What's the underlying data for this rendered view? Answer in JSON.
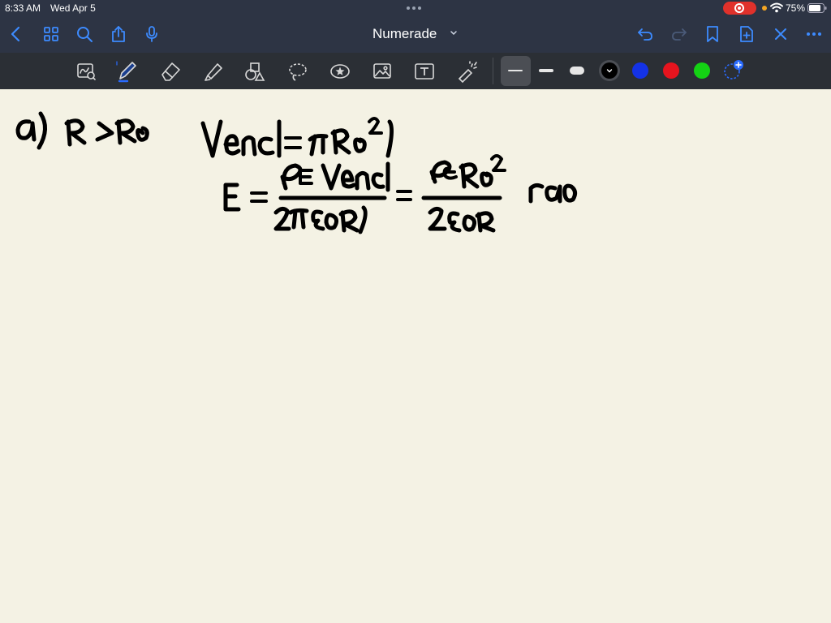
{
  "status": {
    "time": "8:33 AM",
    "date": "Wed Apr 5",
    "battery": "75%"
  },
  "nav": {
    "title": "Numerade"
  },
  "toolbar": {
    "tools": [
      "lasso-zoom",
      "pen",
      "eraser",
      "highlighter",
      "shapes",
      "lasso",
      "stickers",
      "image",
      "text",
      "laser-pointer"
    ],
    "stroke_sizes": [
      "thin",
      "medium",
      "thick"
    ],
    "colors": [
      "#000000",
      "#1432e6",
      "#e6141e",
      "#14d214"
    ],
    "selected_color": "#000000"
  },
  "canvas": {
    "handwriting": {
      "line1_left": "a) R > R0",
      "line1_right": "Vencl = πR0²l",
      "line2": "E = ρE Vencl / 2πε0Rl = ρE R0² / 2ε0R  rαo"
    }
  }
}
